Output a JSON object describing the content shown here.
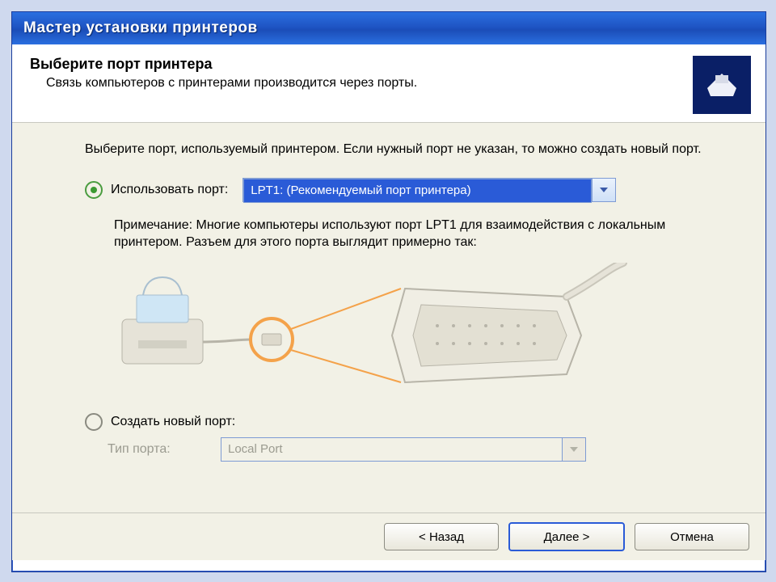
{
  "window": {
    "title": "Мастер установки принтеров"
  },
  "header": {
    "title": "Выберите порт принтера",
    "subtitle": "Связь компьютеров с принтерами производится через порты."
  },
  "content": {
    "instruction": "Выберите порт, используемый принтером. Если нужный порт не указан, то можно создать новый порт.",
    "use_port_label": "Использовать порт:",
    "use_port_value": "LPT1: (Рекомендуемый порт принтера)",
    "note": "Примечание: Многие компьютеры используют порт LPT1 для взаимодействия с локальным принтером. Разъем для этого порта выглядит примерно так:",
    "create_port_label": "Создать новый порт:",
    "port_type_label": "Тип порта:",
    "port_type_value": "Local Port"
  },
  "footer": {
    "back": "< Назад",
    "next": "Далее >",
    "cancel": "Отмена"
  }
}
